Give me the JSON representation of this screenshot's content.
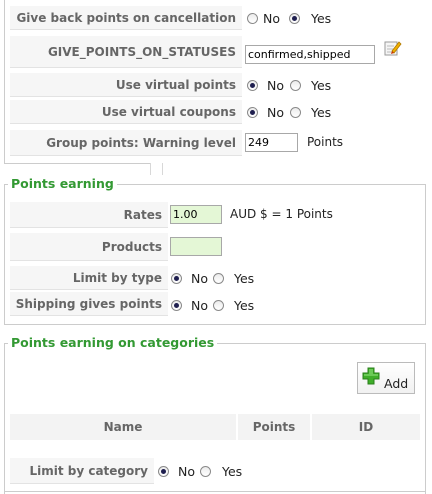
{
  "global_settings": {
    "give_back_points": {
      "label": "Give back points on cancellation",
      "options": [
        "No",
        "Yes"
      ],
      "selected": "Yes"
    },
    "statuses": {
      "label": "GIVE_POINTS_ON_STATUSES",
      "value": "confirmed,shipped",
      "edit_icon": "edit-pencil-icon"
    },
    "virtual_points": {
      "label": "Use virtual points",
      "options": [
        "No",
        "Yes"
      ],
      "selected": "No"
    },
    "virtual_coupons": {
      "label": "Use virtual coupons",
      "options": [
        "No",
        "Yes"
      ],
      "selected": "No"
    },
    "warning_level": {
      "label": "Group points: Warning level",
      "value": "249",
      "unit": "Points"
    }
  },
  "points_earning": {
    "legend": "Points earning",
    "rates": {
      "label": "Rates",
      "value": "1.00",
      "suffix": "AUD $ = 1 Points"
    },
    "products": {
      "label": "Products",
      "value": ""
    },
    "limit_by_type": {
      "label": "Limit by type",
      "options": [
        "No",
        "Yes"
      ],
      "selected": "No"
    },
    "shipping": {
      "label": "Shipping gives points",
      "options": [
        "No",
        "Yes"
      ],
      "selected": "No"
    }
  },
  "categories": {
    "legend": "Points earning on categories",
    "add_button": {
      "label": "Add",
      "icon": "green-plus-icon"
    },
    "columns": [
      "Name",
      "Points",
      "ID"
    ],
    "limit_by_category": {
      "label": "Limit by category",
      "options": [
        "No",
        "Yes"
      ],
      "selected": "No"
    }
  },
  "colors": {
    "legend": "#339933",
    "label": "#666666",
    "input_green": "#e4f7d6"
  }
}
